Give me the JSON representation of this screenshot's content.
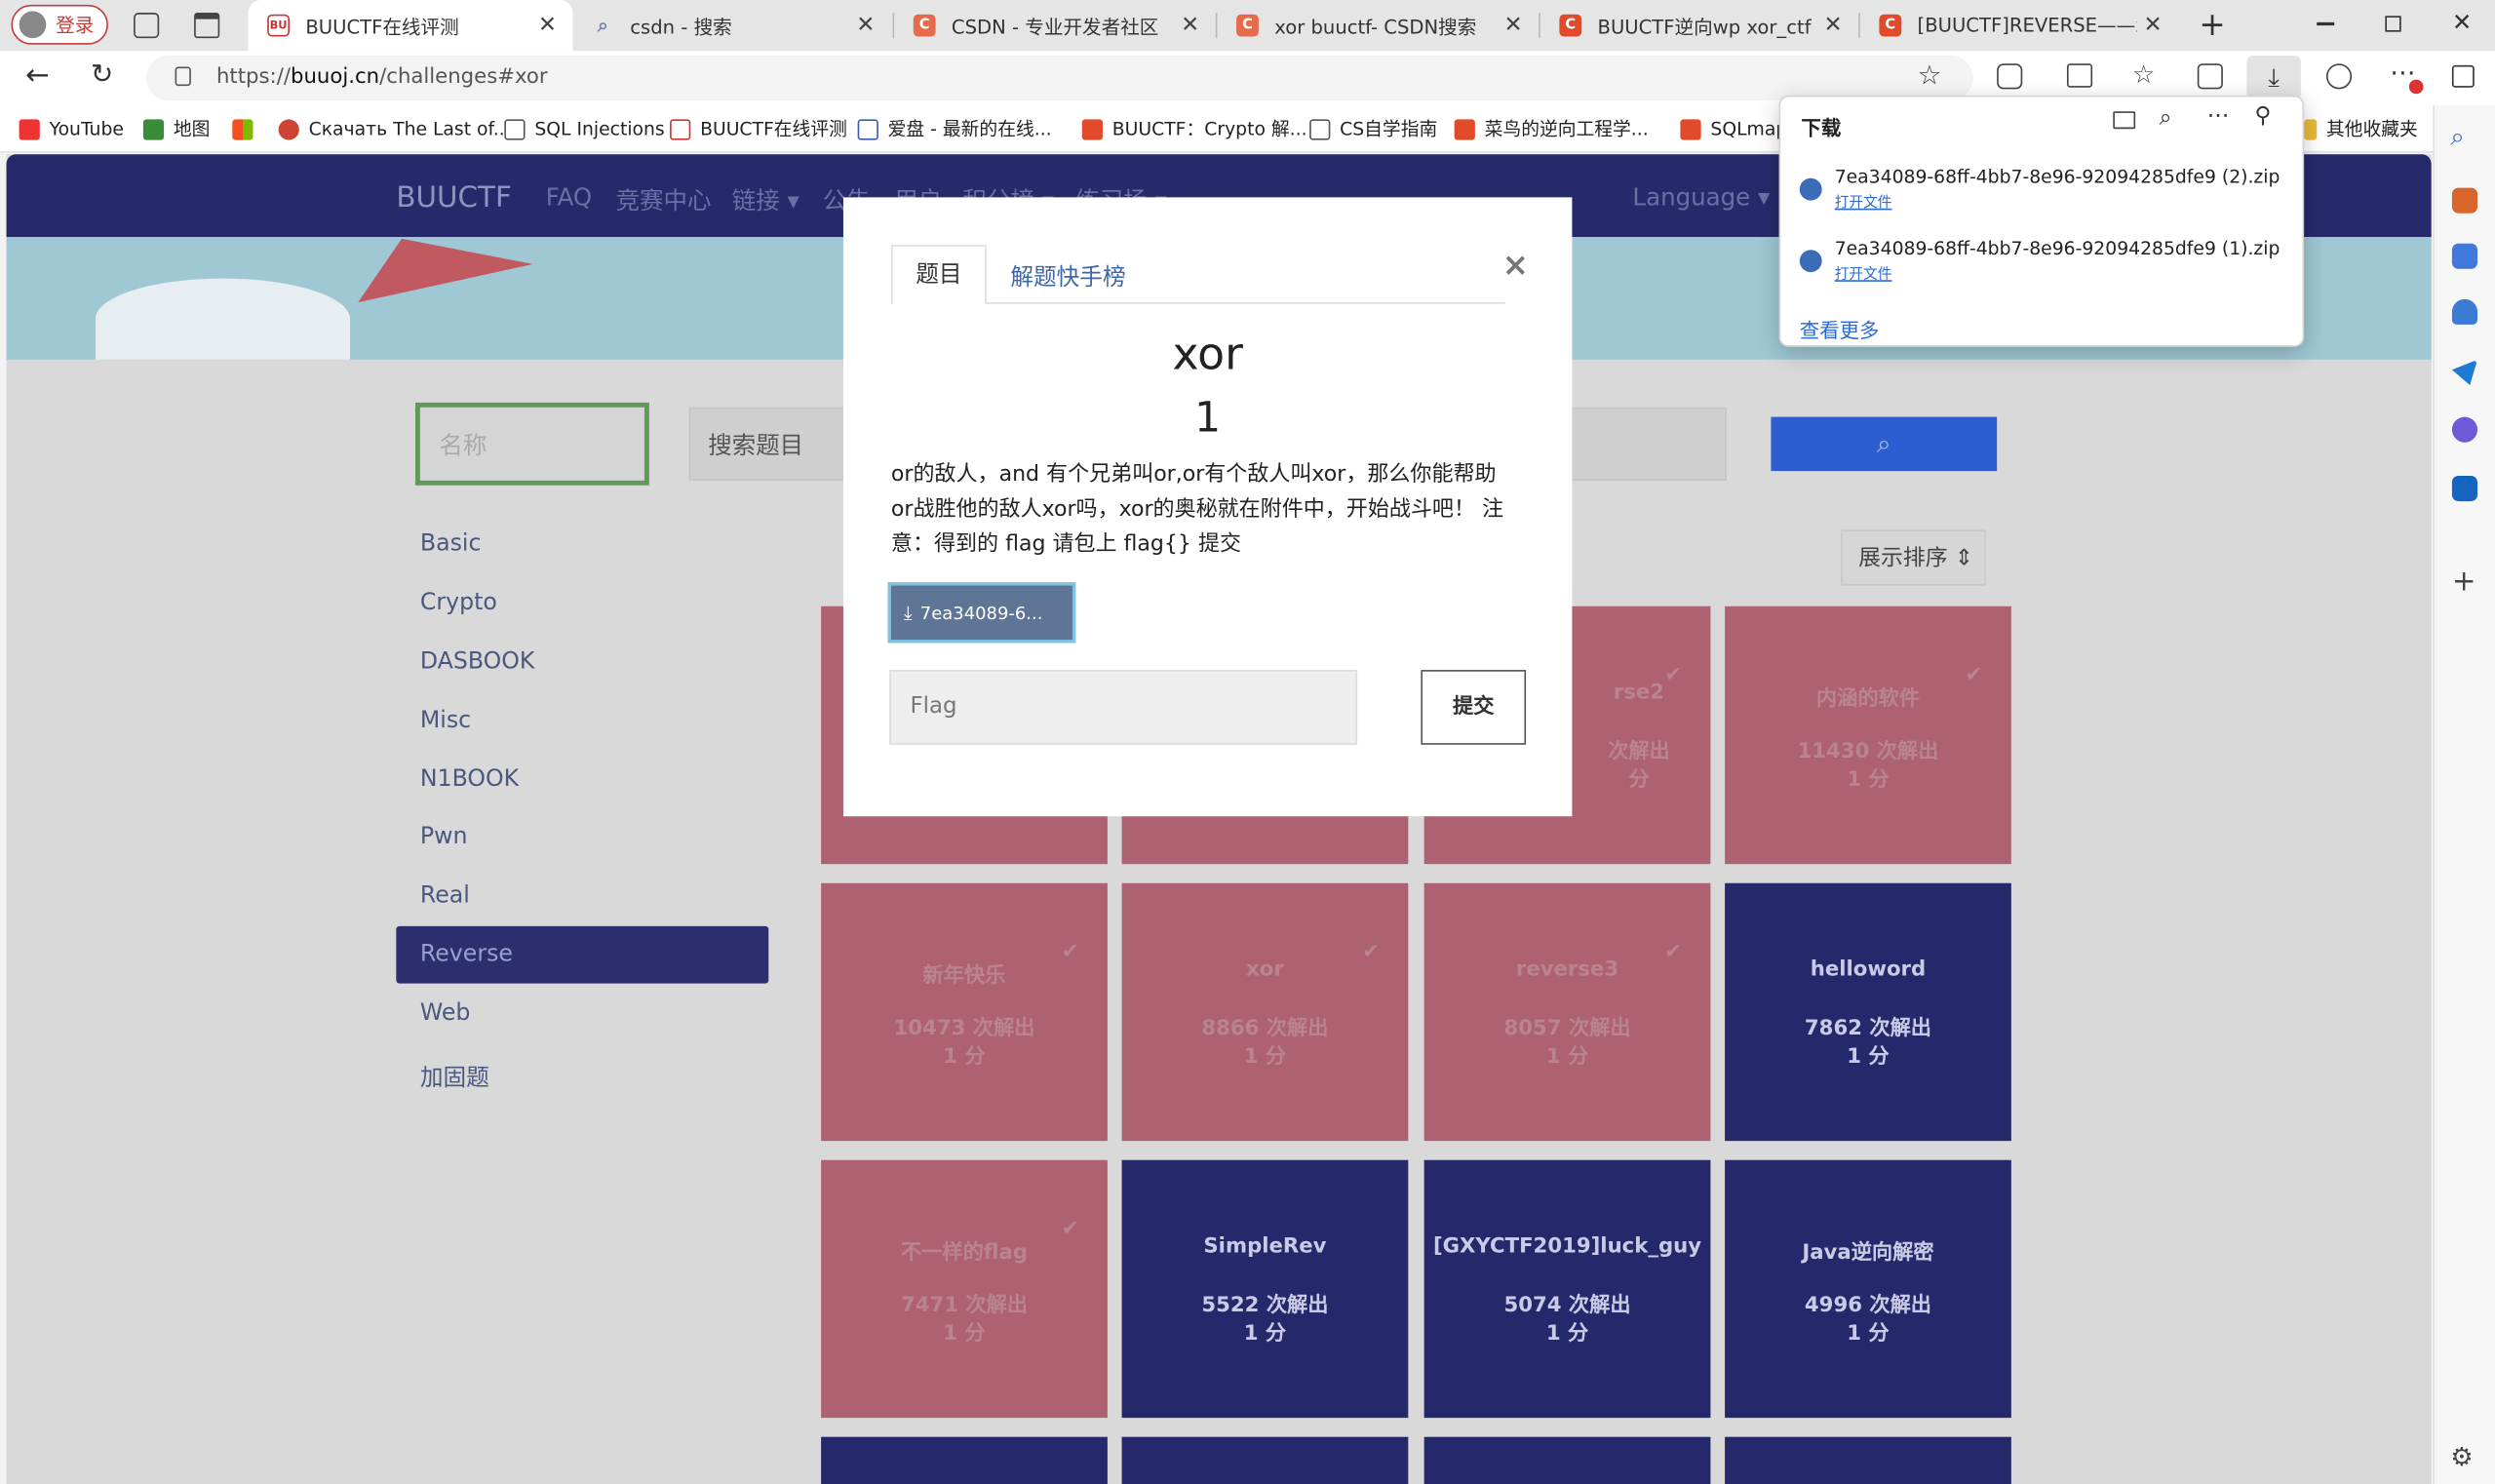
{
  "browser": {
    "profile_label": "登录",
    "tabs": [
      {
        "title": "BUUCTF在线评测",
        "active": true
      },
      {
        "title": "csdn - 搜索",
        "active": false
      },
      {
        "title": "CSDN - 专业开发者社区",
        "active": false
      },
      {
        "title": "xor buuctf- CSDN搜索",
        "active": false
      },
      {
        "title": "BUUCTF逆向wp xor_ctf 异或逆",
        "active": false
      },
      {
        "title": "[BUUCTF]REVERSE——xor_ct",
        "active": false
      }
    ],
    "address": {
      "prefix": "https://",
      "domain": "buuoj.cn",
      "path": "/challenges#xor"
    },
    "bookmarks": [
      "YouTube",
      "地图",
      "Скачать The Last of...",
      "SQL Injections",
      "BUUCTF在线评测",
      "爱盘 - 最新的在线...",
      "BUUCTF：Crypto 解...",
      "CS自学指南",
      "菜鸟的逆向工程学...",
      "SQLmap",
      "其他收藏夹"
    ],
    "downloads": {
      "title": "下载",
      "items": [
        {
          "file": "7ea34089-68ff-4bb7-8e96-92094285dfe9 (2).zip",
          "action": "打开文件"
        },
        {
          "file": "7ea34089-68ff-4bb7-8e96-92094285dfe9 (1).zip",
          "action": "打开文件"
        }
      ],
      "more": "查看更多"
    }
  },
  "site": {
    "brand": "BUUCTF",
    "nav": [
      "FAQ",
      "竞赛中心",
      "链接 ▾",
      "公告",
      "用户",
      "积分榜 ▾",
      "练习场 ▾"
    ],
    "language": "Language ▾",
    "filter_name_placeholder": "名称",
    "search_placeholder": "搜索题目",
    "sort_label": "展示排序 ⇕",
    "categories": [
      "Basic",
      "Crypto",
      "DASBOOK",
      "Misc",
      "N1BOOK",
      "Pwn",
      "Real",
      "Reverse",
      "Web",
      "加固题"
    ],
    "active_category": "Reverse",
    "cards": [
      {
        "name": "",
        "solves": "",
        "points": "",
        "solved": true
      },
      {
        "name": "",
        "solves": "",
        "points": "",
        "solved": true
      },
      {
        "name": "rse2",
        "solves": "次解出",
        "points": "分",
        "solved": true
      },
      {
        "name": "内涵的软件",
        "solves": "11430 次解出",
        "points": "1 分",
        "solved": true
      },
      {
        "name": "新年快乐",
        "solves": "10473 次解出",
        "points": "1 分",
        "solved": true
      },
      {
        "name": "xor",
        "solves": "8866 次解出",
        "points": "1 分",
        "solved": true
      },
      {
        "name": "reverse3",
        "solves": "8057 次解出",
        "points": "1 分",
        "solved": true
      },
      {
        "name": "helloword",
        "solves": "7862 次解出",
        "points": "1 分",
        "solved": false
      },
      {
        "name": "不一样的flag",
        "solves": "7471 次解出",
        "points": "1 分",
        "solved": true
      },
      {
        "name": "SimpleRev",
        "solves": "5522 次解出",
        "points": "1 分",
        "solved": false
      },
      {
        "name": "[GXYCTF2019]luck_guy",
        "solves": "5074 次解出",
        "points": "1 分",
        "solved": false
      },
      {
        "name": "Java逆向解密",
        "solves": "4996 次解出",
        "points": "1 分",
        "solved": false
      }
    ]
  },
  "modal": {
    "tab_active": "题目",
    "tab_other": "解题快手榜",
    "close": "×",
    "title": "xor",
    "score": "1",
    "description": "or的敌人，and 有个兄弟叫or,or有个敌人叫xor，那么你能帮助or战胜他的敌人xor吗，xor的奥秘就在附件中，开始战斗吧！ 注意：得到的 flag 请包上 flag{} 提交",
    "download_label": "7ea34089-6...",
    "flag_placeholder": "Flag",
    "submit": "提交"
  },
  "colors": {
    "nav": "#262a6b",
    "card_solved": "#ae6271",
    "card_unsolved": "#25286a",
    "accent": "#2b5fcf"
  }
}
